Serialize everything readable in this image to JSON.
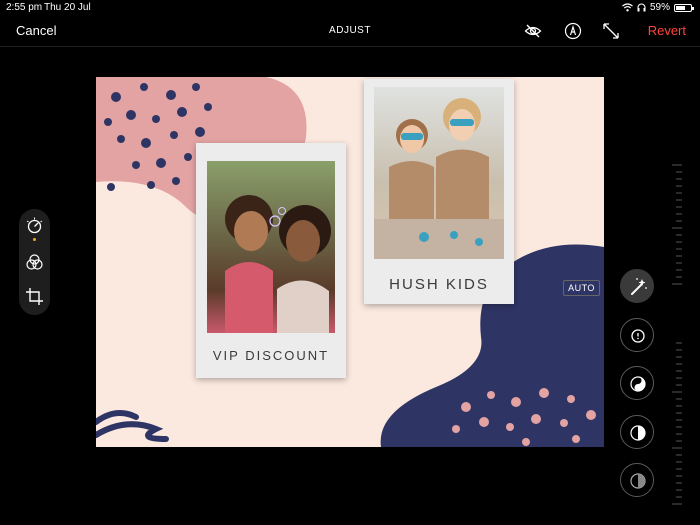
{
  "status_bar": {
    "time": "2:55 pm",
    "date": "Thu 20 Jul",
    "battery": "59%",
    "battery_level": 0.59
  },
  "toolbar": {
    "cancel_label": "Cancel",
    "title": "ADJUST",
    "revert_label": "Revert",
    "revert_color": "#ff453a",
    "icons": [
      "eye-slash-icon",
      "markup-pen-icon",
      "resize-arrows-icon"
    ]
  },
  "canvas": {
    "background": "#fbe9df",
    "accent_pink": "#e3a3a3",
    "accent_navy": "#2e3565",
    "polaroids": [
      {
        "caption": "VIP DISCOUNT"
      },
      {
        "caption": "HUSH KIDS"
      }
    ]
  },
  "left_panel": {
    "tools": [
      "adjust-dial-icon",
      "filters-icon",
      "crop-rotate-icon"
    ]
  },
  "right_panel": {
    "auto_label": "AUTO",
    "tools": [
      "magic-wand-icon",
      "exposure-icon",
      "brilliance-icon",
      "highlights-icon",
      "shadows-icon"
    ]
  }
}
